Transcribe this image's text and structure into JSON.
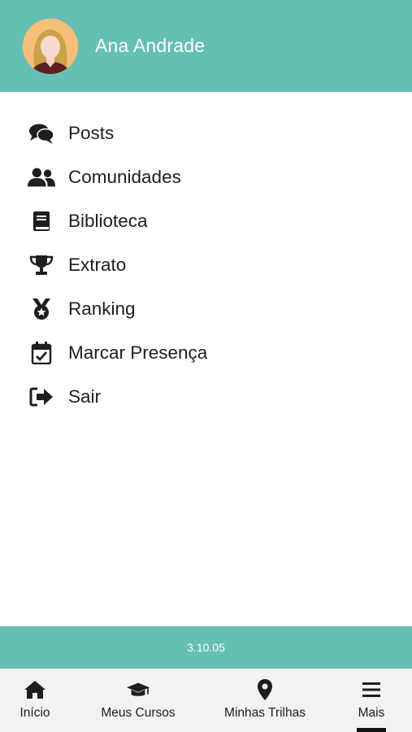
{
  "header": {
    "user_name": "Ana Andrade",
    "background_color": "#66bfb4",
    "avatar_icon": "user-avatar-icon"
  },
  "menu": {
    "items": [
      {
        "label": "Posts",
        "icon": "comments-icon"
      },
      {
        "label": "Comunidades",
        "icon": "users-icon"
      },
      {
        "label": "Biblioteca",
        "icon": "book-icon"
      },
      {
        "label": "Extrato",
        "icon": "trophy-icon"
      },
      {
        "label": "Ranking",
        "icon": "medal-icon"
      },
      {
        "label": "Marcar Presença",
        "icon": "calendar-check-icon"
      },
      {
        "label": "Sair",
        "icon": "sign-out-icon"
      }
    ]
  },
  "version": "3.10.05",
  "tabbar": {
    "tabs": [
      {
        "label": "Início",
        "icon": "home-icon"
      },
      {
        "label": "Meus Cursos",
        "icon": "graduation-cap-icon"
      },
      {
        "label": "Minhas Trilhas",
        "icon": "map-marker-icon"
      },
      {
        "label": "Mais",
        "icon": "bars-icon",
        "active": true
      }
    ]
  }
}
